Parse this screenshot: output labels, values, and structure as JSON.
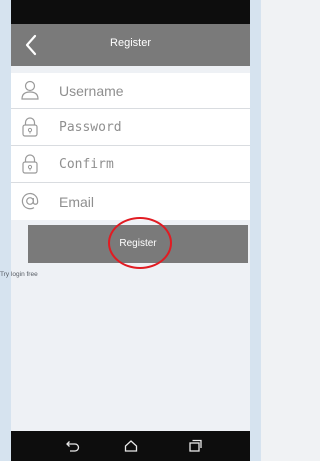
{
  "header": {
    "title": "Register",
    "back_icon": "chevron-left-icon"
  },
  "form": {
    "fields": [
      {
        "name": "username",
        "icon": "user-icon",
        "value": "Username"
      },
      {
        "name": "password",
        "icon": "lock-icon",
        "value": "Password"
      },
      {
        "name": "confirm",
        "icon": "lock-icon",
        "value": "Confirm"
      },
      {
        "name": "email",
        "icon": "at-sign-icon",
        "value": "Email"
      }
    ]
  },
  "register_button": {
    "label": "Register"
  },
  "links": {
    "try_login": "Try login free"
  },
  "nav_bar": {
    "buttons": [
      "back-icon",
      "home-icon",
      "recents-icon"
    ]
  },
  "colors": {
    "header_bg": "#7a7a7a",
    "button_bg": "#7a7a7a",
    "highlight": "#e11b22"
  }
}
